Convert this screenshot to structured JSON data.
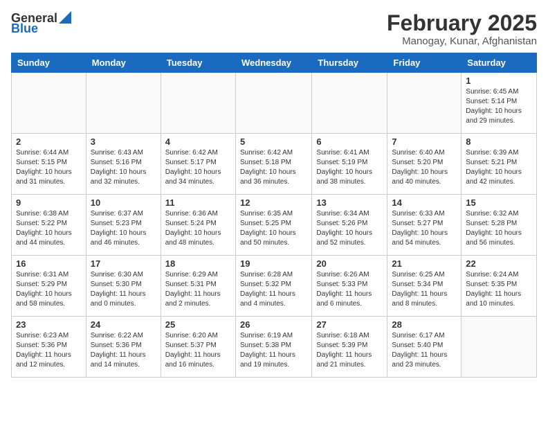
{
  "logo": {
    "general": "General",
    "blue": "Blue"
  },
  "header": {
    "title": "February 2025",
    "subtitle": "Manogay, Kunar, Afghanistan"
  },
  "weekdays": [
    "Sunday",
    "Monday",
    "Tuesday",
    "Wednesday",
    "Thursday",
    "Friday",
    "Saturday"
  ],
  "weeks": [
    [
      {
        "day": "",
        "info": ""
      },
      {
        "day": "",
        "info": ""
      },
      {
        "day": "",
        "info": ""
      },
      {
        "day": "",
        "info": ""
      },
      {
        "day": "",
        "info": ""
      },
      {
        "day": "",
        "info": ""
      },
      {
        "day": "1",
        "info": "Sunrise: 6:45 AM\nSunset: 5:14 PM\nDaylight: 10 hours and 29 minutes."
      }
    ],
    [
      {
        "day": "2",
        "info": "Sunrise: 6:44 AM\nSunset: 5:15 PM\nDaylight: 10 hours and 31 minutes."
      },
      {
        "day": "3",
        "info": "Sunrise: 6:43 AM\nSunset: 5:16 PM\nDaylight: 10 hours and 32 minutes."
      },
      {
        "day": "4",
        "info": "Sunrise: 6:42 AM\nSunset: 5:17 PM\nDaylight: 10 hours and 34 minutes."
      },
      {
        "day": "5",
        "info": "Sunrise: 6:42 AM\nSunset: 5:18 PM\nDaylight: 10 hours and 36 minutes."
      },
      {
        "day": "6",
        "info": "Sunrise: 6:41 AM\nSunset: 5:19 PM\nDaylight: 10 hours and 38 minutes."
      },
      {
        "day": "7",
        "info": "Sunrise: 6:40 AM\nSunset: 5:20 PM\nDaylight: 10 hours and 40 minutes."
      },
      {
        "day": "8",
        "info": "Sunrise: 6:39 AM\nSunset: 5:21 PM\nDaylight: 10 hours and 42 minutes."
      }
    ],
    [
      {
        "day": "9",
        "info": "Sunrise: 6:38 AM\nSunset: 5:22 PM\nDaylight: 10 hours and 44 minutes."
      },
      {
        "day": "10",
        "info": "Sunrise: 6:37 AM\nSunset: 5:23 PM\nDaylight: 10 hours and 46 minutes."
      },
      {
        "day": "11",
        "info": "Sunrise: 6:36 AM\nSunset: 5:24 PM\nDaylight: 10 hours and 48 minutes."
      },
      {
        "day": "12",
        "info": "Sunrise: 6:35 AM\nSunset: 5:25 PM\nDaylight: 10 hours and 50 minutes."
      },
      {
        "day": "13",
        "info": "Sunrise: 6:34 AM\nSunset: 5:26 PM\nDaylight: 10 hours and 52 minutes."
      },
      {
        "day": "14",
        "info": "Sunrise: 6:33 AM\nSunset: 5:27 PM\nDaylight: 10 hours and 54 minutes."
      },
      {
        "day": "15",
        "info": "Sunrise: 6:32 AM\nSunset: 5:28 PM\nDaylight: 10 hours and 56 minutes."
      }
    ],
    [
      {
        "day": "16",
        "info": "Sunrise: 6:31 AM\nSunset: 5:29 PM\nDaylight: 10 hours and 58 minutes."
      },
      {
        "day": "17",
        "info": "Sunrise: 6:30 AM\nSunset: 5:30 PM\nDaylight: 11 hours and 0 minutes."
      },
      {
        "day": "18",
        "info": "Sunrise: 6:29 AM\nSunset: 5:31 PM\nDaylight: 11 hours and 2 minutes."
      },
      {
        "day": "19",
        "info": "Sunrise: 6:28 AM\nSunset: 5:32 PM\nDaylight: 11 hours and 4 minutes."
      },
      {
        "day": "20",
        "info": "Sunrise: 6:26 AM\nSunset: 5:33 PM\nDaylight: 11 hours and 6 minutes."
      },
      {
        "day": "21",
        "info": "Sunrise: 6:25 AM\nSunset: 5:34 PM\nDaylight: 11 hours and 8 minutes."
      },
      {
        "day": "22",
        "info": "Sunrise: 6:24 AM\nSunset: 5:35 PM\nDaylight: 11 hours and 10 minutes."
      }
    ],
    [
      {
        "day": "23",
        "info": "Sunrise: 6:23 AM\nSunset: 5:36 PM\nDaylight: 11 hours and 12 minutes."
      },
      {
        "day": "24",
        "info": "Sunrise: 6:22 AM\nSunset: 5:36 PM\nDaylight: 11 hours and 14 minutes."
      },
      {
        "day": "25",
        "info": "Sunrise: 6:20 AM\nSunset: 5:37 PM\nDaylight: 11 hours and 16 minutes."
      },
      {
        "day": "26",
        "info": "Sunrise: 6:19 AM\nSunset: 5:38 PM\nDaylight: 11 hours and 19 minutes."
      },
      {
        "day": "27",
        "info": "Sunrise: 6:18 AM\nSunset: 5:39 PM\nDaylight: 11 hours and 21 minutes."
      },
      {
        "day": "28",
        "info": "Sunrise: 6:17 AM\nSunset: 5:40 PM\nDaylight: 11 hours and 23 minutes."
      },
      {
        "day": "",
        "info": ""
      }
    ]
  ]
}
